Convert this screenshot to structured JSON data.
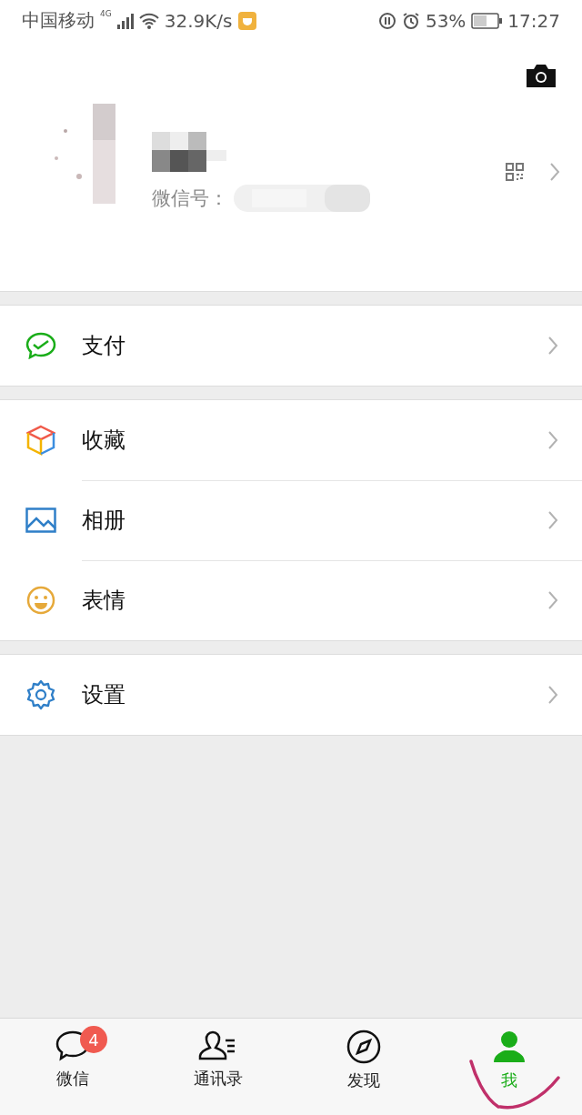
{
  "status_bar": {
    "carrier": "中国移动",
    "network": "4G",
    "speed": "32.9K/s",
    "battery": "53%",
    "time": "17:27"
  },
  "profile": {
    "id_label": "微信号："
  },
  "menu_groups": [
    [
      {
        "label": "支付",
        "kind": "pay"
      }
    ],
    [
      {
        "label": "收藏",
        "kind": "favorites"
      },
      {
        "label": "相册",
        "kind": "album"
      },
      {
        "label": "表情",
        "kind": "sticker"
      }
    ],
    [
      {
        "label": "设置",
        "kind": "settings"
      }
    ]
  ],
  "tabs": [
    {
      "label": "微信",
      "kind": "chat",
      "badge": "4",
      "selected": false
    },
    {
      "label": "通讯录",
      "kind": "contacts",
      "selected": false
    },
    {
      "label": "发现",
      "kind": "discover",
      "selected": false
    },
    {
      "label": "我",
      "kind": "me",
      "selected": true
    }
  ]
}
